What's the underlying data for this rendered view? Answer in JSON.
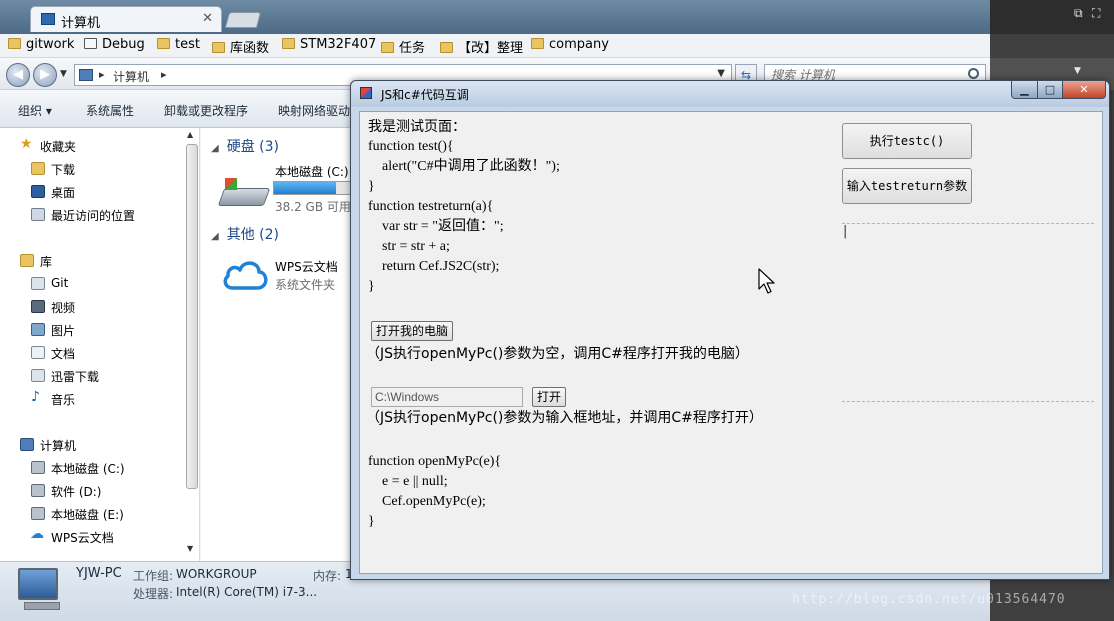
{
  "explorer": {
    "tab": {
      "label": "计算机"
    },
    "bookmarks": [
      "gitwork",
      "Debug",
      "test",
      "库函数",
      "STM32F407",
      "任务",
      "【改】整理",
      "company"
    ],
    "address": {
      "location": "计算机",
      "search_placeholder": "搜索 计算机"
    },
    "commands": [
      "组织 ▾",
      "系统属性",
      "卸载或更改程序",
      "映射网络驱动"
    ],
    "nav": {
      "favorites_title": "收藏夹",
      "favorites": [
        "下载",
        "桌面",
        "最近访问的位置"
      ],
      "library_title": "库",
      "libraries": [
        "Git",
        "视频",
        "图片",
        "文档",
        "迅雷下载",
        "音乐"
      ],
      "computer_title": "计算机",
      "drives": [
        "本地磁盘 (C:)",
        "软件 (D:)",
        "本地磁盘 (E:)",
        "WPS云文档"
      ]
    },
    "content": {
      "group_disks": "硬盘 (3)",
      "disk_c_name": "本地磁盘 (C:)",
      "disk_c_free": "38.2 GB 可用",
      "disk_c_used_fraction": 0.8,
      "group_other": "其他 (2)",
      "wps_name": "WPS云文档",
      "wps_sub": "系统文件夹"
    },
    "details": {
      "name": "YJW-PC",
      "workgroup_label": "工作组:",
      "workgroup_value": "WORKGROUP",
      "memory_label": "内存:",
      "memory_value": "1",
      "cpu_label": "处理器:",
      "cpu_value": "Intel(R) Core(TM) i7-3..."
    }
  },
  "dialog": {
    "title": "JS和c#代码互调",
    "page": {
      "intro": "我是测试页面：",
      "code1": "function test(){\n    alert(\"C#中调用了此函数！\");\n}\nfunction testreturn(a){\n    var str = \"返回值：\";\n    str = str + a;\n    return Cef.JS2C(str);\n}",
      "open_pc_button": "打开我的电脑",
      "open_pc_note": "（JS执行openMyPc()参数为空，调用C#程序打开我的电脑）",
      "path_value": "C:\\Windows",
      "open_button": "打开",
      "open_note": "（JS执行openMyPc()参数为输入框地址，并调用C#程序打开）",
      "code2": "function openMyPc(e){\n    e = e || null;\n    Cef.openMyPc(e);\n}"
    },
    "form": {
      "exec_button": "执行testc()",
      "input_button": "输入testreturn参数",
      "text_caret": "|"
    }
  },
  "watermark": "http://blog.csdn.net/u013564470"
}
